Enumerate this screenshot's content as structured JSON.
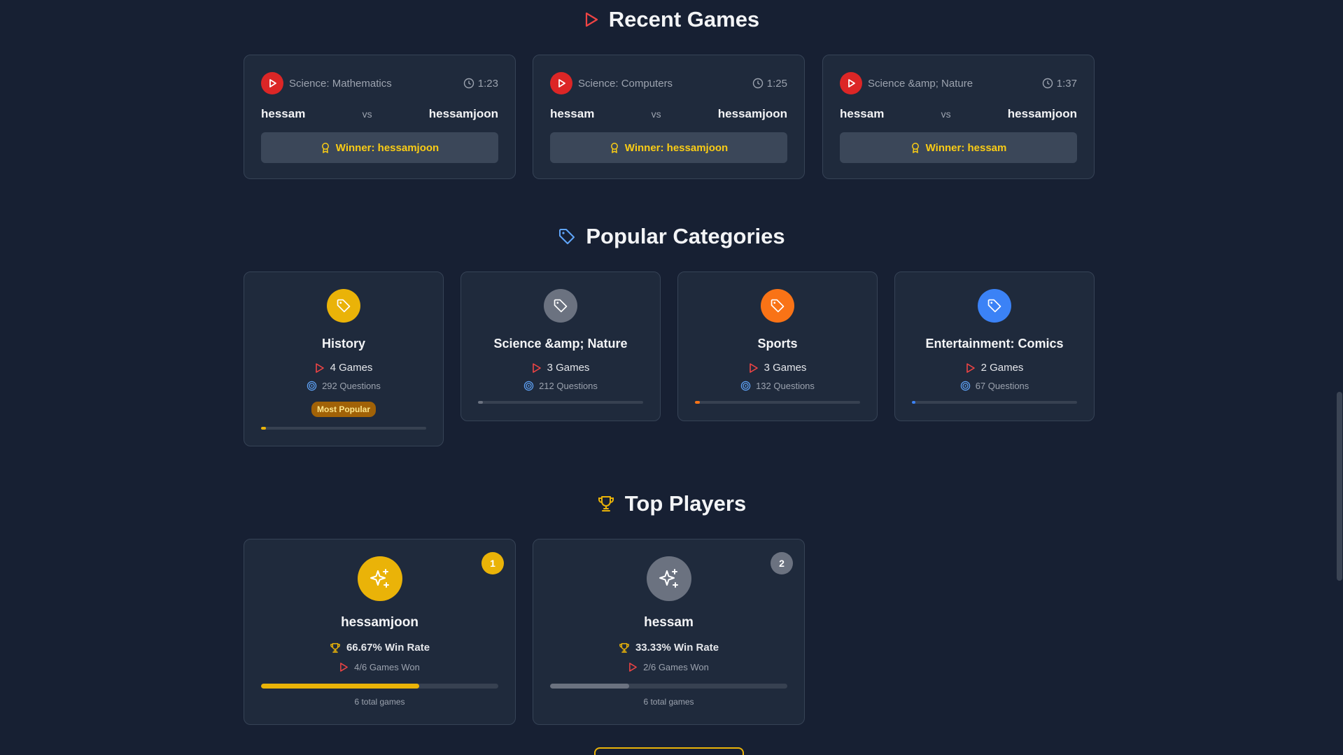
{
  "colors": {
    "background": "#172033",
    "card": "#1f2a3c",
    "accent_red": "#ef4444",
    "accent_yellow": "#eab308",
    "accent_blue": "#60a5fa"
  },
  "recent_games": {
    "title": "Recent Games",
    "icon": "play-icon",
    "games": [
      {
        "category": "Science: Mathematics",
        "time": "1:23",
        "player1": "hessam",
        "vs": "vs",
        "player2": "hessamjoon",
        "winner": "Winner: hessamjoon"
      },
      {
        "category": "Science: Computers",
        "time": "1:25",
        "player1": "hessam",
        "vs": "vs",
        "player2": "hessamjoon",
        "winner": "Winner: hessamjoon"
      },
      {
        "category": "Science &amp; Nature",
        "time": "1:37",
        "player1": "hessam",
        "vs": "vs",
        "player2": "hessamjoon",
        "winner": "Winner: hessam"
      }
    ]
  },
  "popular_categories": {
    "title": "Popular Categories",
    "icon": "tag-icon",
    "categories": [
      {
        "name": "History",
        "games": "4 Games",
        "questions": "292 Questions",
        "badge": "Most Popular",
        "color": "#eab308",
        "popularity": 0.03
      },
      {
        "name": "Science &amp; Nature",
        "games": "3 Games",
        "questions": "212 Questions",
        "color": "#6b7280",
        "popularity": 0.03
      },
      {
        "name": "Sports",
        "games": "3 Games",
        "questions": "132 Questions",
        "color": "#f97316",
        "popularity": 0.03
      },
      {
        "name": "Entertainment: Comics",
        "games": "2 Games",
        "questions": "67 Questions",
        "color": "#3b82f6",
        "popularity": 0.02
      }
    ]
  },
  "top_players": {
    "title": "Top Players",
    "icon": "trophy-icon",
    "players": [
      {
        "rank": "1",
        "name": "hessamjoon",
        "win_rate": "66.67% Win Rate",
        "games_won": "4/6 Games Won",
        "total": "6 total games",
        "win_fraction": 0.6667,
        "color": "#eab308"
      },
      {
        "rank": "2",
        "name": "hessam",
        "win_rate": "33.33% Win Rate",
        "games_won": "2/6 Games Won",
        "total": "6 total games",
        "win_fraction": 0.3333,
        "color": "#6b7280"
      }
    ]
  }
}
